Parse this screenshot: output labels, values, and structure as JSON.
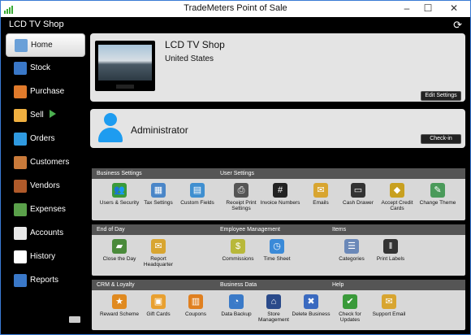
{
  "window": {
    "title": "TradeMeters Point of Sale",
    "min": "–",
    "max": "☐",
    "close": "✕"
  },
  "shop_bar": {
    "name": "LCD TV Shop",
    "refresh_icon": "⟳"
  },
  "sidebar": {
    "items": [
      {
        "label": "Home",
        "icon": "home-icon",
        "color": "#6aa0d8"
      },
      {
        "label": "Stock",
        "icon": "stock-icon",
        "color": "#3a78c8"
      },
      {
        "label": "Purchase",
        "icon": "purchase-icon",
        "color": "#e07a2b"
      },
      {
        "label": "Sell",
        "icon": "sell-icon",
        "color": "#f0b040"
      },
      {
        "label": "Orders",
        "icon": "orders-icon",
        "color": "#2f9ae0"
      },
      {
        "label": "Customers",
        "icon": "customers-icon",
        "color": "#c97a3a"
      },
      {
        "label": "Vendors",
        "icon": "vendors-icon",
        "color": "#b05a2a"
      },
      {
        "label": "Expenses",
        "icon": "expenses-icon",
        "color": "#5aa04a"
      },
      {
        "label": "Accounts",
        "icon": "accounts-icon",
        "color": "#e8e8e8"
      },
      {
        "label": "History",
        "icon": "history-icon",
        "color": "#ffffff"
      },
      {
        "label": "Reports",
        "icon": "reports-icon",
        "color": "#3a78c8"
      }
    ]
  },
  "shop_card": {
    "name": "LCD TV Shop",
    "country": "United States",
    "button": "Edit Settings"
  },
  "admin_card": {
    "name": "Administrator",
    "button": "Check-in"
  },
  "panels": [
    {
      "headers": [
        "Business Settings",
        "User Settings"
      ],
      "tiles": [
        {
          "label": "Users & Security",
          "icon": "users-icon",
          "glyph": "👥",
          "color": "#3a9a3a"
        },
        {
          "label": "Tax Settings",
          "icon": "calculator-icon",
          "glyph": "▦",
          "color": "#4a86c8"
        },
        {
          "label": "Custom Fields",
          "icon": "custom-fields-icon",
          "glyph": "▤",
          "color": "#3f8fd0"
        },
        {
          "label": "Receipt Print Settings",
          "icon": "printer-icon",
          "glyph": "⎙",
          "color": "#555555"
        },
        {
          "label": "Invoice Numbers",
          "icon": "hash-icon",
          "glyph": "#",
          "color": "#222222"
        },
        {
          "label": "Emails",
          "icon": "email-icon",
          "glyph": "✉",
          "color": "#d8a530"
        },
        {
          "label": "Cash Drawer",
          "icon": "cash-drawer-icon",
          "glyph": "▭",
          "color": "#333333"
        },
        {
          "label": "Accept Credit Cards",
          "icon": "credit-card-icon",
          "glyph": "◆",
          "color": "#c8a020"
        },
        {
          "label": "Change Theme",
          "icon": "theme-icon",
          "glyph": "✎",
          "color": "#4a9a5a"
        }
      ]
    },
    {
      "headers": [
        "End of Day",
        "Employee Management",
        "Items"
      ],
      "tiles": [
        {
          "label": "Close the Day",
          "icon": "close-day-icon",
          "glyph": "▰",
          "color": "#4a8a3a"
        },
        {
          "label": "Report Headquarter",
          "icon": "report-hq-icon",
          "glyph": "✉",
          "color": "#d8a530"
        },
        {
          "label": "Commissions",
          "icon": "commissions-icon",
          "glyph": "$",
          "color": "#b8b83a"
        },
        {
          "label": "Time Sheet",
          "icon": "clock-icon",
          "glyph": "◷",
          "color": "#3a8ad8"
        },
        {
          "label": "Categories",
          "icon": "categories-icon",
          "glyph": "☰",
          "color": "#6a88b8"
        },
        {
          "label": "Print Labels",
          "icon": "barcode-icon",
          "glyph": "‖",
          "color": "#333333"
        }
      ]
    },
    {
      "headers": [
        "CRM & Loyalty",
        "Business Data",
        "Help"
      ],
      "tiles": [
        {
          "label": "Reward Scheme",
          "icon": "reward-icon",
          "glyph": "★",
          "color": "#e08a20"
        },
        {
          "label": "Gift Cards",
          "icon": "gift-card-icon",
          "glyph": "▣",
          "color": "#e8a030"
        },
        {
          "label": "Coupons",
          "icon": "coupons-icon",
          "glyph": "▥",
          "color": "#e08020"
        },
        {
          "label": "Data Backup",
          "icon": "backup-icon",
          "glyph": "◔",
          "color": "#3a7ac8"
        },
        {
          "label": "Store Management",
          "icon": "store-icon",
          "glyph": "⌂",
          "color": "#2a4a8a"
        },
        {
          "label": "Delete Business",
          "icon": "delete-business-icon",
          "glyph": "✖",
          "color": "#3a6ac0"
        },
        {
          "label": "Check for Updates",
          "icon": "checkmark-icon",
          "glyph": "✔",
          "color": "#3a9a3a"
        },
        {
          "label": "Support Email",
          "icon": "support-email-icon",
          "glyph": "✉",
          "color": "#d8a530"
        }
      ]
    }
  ]
}
